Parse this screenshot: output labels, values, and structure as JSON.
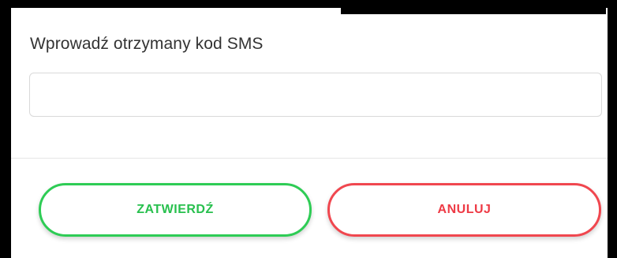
{
  "dialog": {
    "label": "Wprowadź otrzymany kod SMS",
    "sms_input": {
      "value": "",
      "placeholder": ""
    },
    "confirm_label": "ZATWIERDŹ",
    "cancel_label": "ANULUJ"
  },
  "colors": {
    "confirm": "#2ecc55",
    "cancel": "#f0474f",
    "frame": "#000000"
  }
}
